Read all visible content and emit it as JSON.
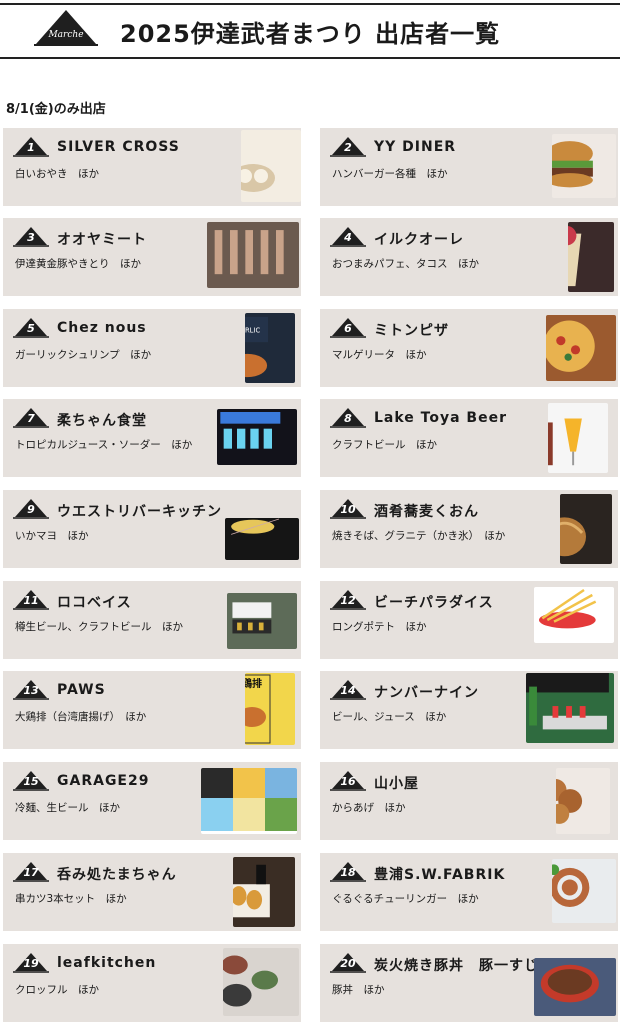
{
  "header": {
    "logo_text": "Marche",
    "title": "2025伊達武者まつり 出店者一覧"
  },
  "section": {
    "label": "8/1(金)のみ出店"
  },
  "vendors": [
    {
      "num": "1",
      "name": "SILVER CROSS",
      "items": "白いおやき　ほか",
      "photo": "oyaki-photo"
    },
    {
      "num": "2",
      "name": "YY DINER",
      "items": "ハンバーガー各種　ほか",
      "photo": "burger-photo"
    },
    {
      "num": "3",
      "name": "オオヤミート",
      "items": "伊達黄金豚やきとり　ほか",
      "photo": "yakitori-photo"
    },
    {
      "num": "4",
      "name": "イルクオーレ",
      "items": "おつまみパフェ、タコス　ほか",
      "photo": "parfait-photo"
    },
    {
      "num": "5",
      "name": "Chez nous",
      "items": "ガーリックシュリンプ　ほか",
      "photo": "shrimp-photo"
    },
    {
      "num": "6",
      "name": "ミトンピザ",
      "items": "マルゲリータ　ほか",
      "photo": "pizza-photo"
    },
    {
      "num": "7",
      "name": "柔ちゃん食堂",
      "items": "トロピカルジュース・ソーダー　ほか",
      "photo": "soda-photo"
    },
    {
      "num": "8",
      "name": "Lake Toya Beer",
      "items": "クラフトビール　ほか",
      "photo": "beer-photo"
    },
    {
      "num": "9",
      "name": "ウエストリバーキッチン",
      "items": "いかマヨ　ほか",
      "photo": "squid-photo"
    },
    {
      "num": "10",
      "name": "酒肴蕎麦くおん",
      "items": "焼きそば、グラニテ（かき氷）　ほか",
      "photo": "yakisoba-photo"
    },
    {
      "num": "11",
      "name": "ロコベイス",
      "items": "樽生ビール、クラフトビール　ほか",
      "photo": "beer-stand-photo"
    },
    {
      "num": "12",
      "name": "ビーチパラダイス",
      "items": "ロングポテト　ほか",
      "photo": "fries-photo"
    },
    {
      "num": "13",
      "name": "PAWS",
      "items": "大鶏排（台湾唐揚げ）　ほか",
      "photo": "fried-chicken-poster",
      "photo_text": "大鶏排"
    },
    {
      "num": "14",
      "name": "ナンバーナイン",
      "items": "ビール、ジュース　ほか",
      "photo": "drinks-stand-photo"
    },
    {
      "num": "15",
      "name": "GARAGE29",
      "items": "冷麺、生ビール　ほか",
      "photo": "noodles-collage-photo"
    },
    {
      "num": "16",
      "name": "山小屋",
      "items": "からあげ　ほか",
      "photo": "karaage-photo"
    },
    {
      "num": "17",
      "name": "呑み処たまちゃん",
      "items": "串カツ3本セット　ほか",
      "photo": "kushikatsu-photo"
    },
    {
      "num": "18",
      "name": "豊浦S.W.FABRIK",
      "items": "ぐるぐるチューリンガー　ほか",
      "photo": "sausage-photo"
    },
    {
      "num": "19",
      "name": "leafkitchen",
      "items": "クロッフル　ほか",
      "photo": "croffle-photo"
    },
    {
      "num": "20",
      "name": "炭火焼き豚丼　豚一すじ",
      "items": "豚丼　ほか",
      "photo": "butadon-photo"
    }
  ],
  "colors": {
    "card_bg": "#e6e1dd",
    "tent": "#1f1f1f",
    "text": "#1a1a1a"
  }
}
